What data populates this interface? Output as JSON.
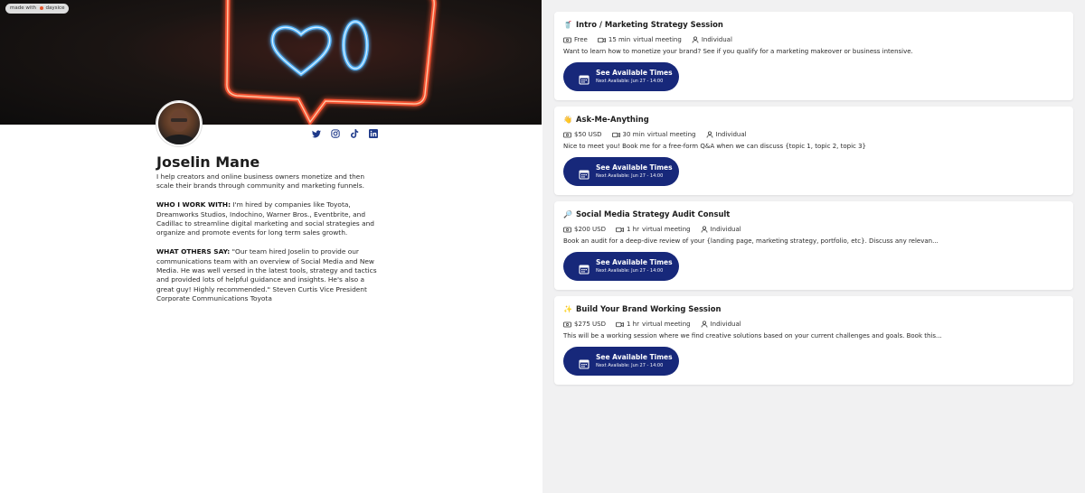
{
  "badge": {
    "made_with": "made with",
    "brand": "daysice"
  },
  "profile": {
    "name": "Joselin Mane",
    "intro": "I help creators and online business owners monetize and then scale their brands through community and marketing funnels.",
    "who_label": "WHO I WORK WITH:",
    "who_text": " I'm hired by companies like Toyota, Dreamworks Studios, Indochino, Warner Bros., Eventbrite, and Cadillac to streamline digital marketing and social strategies and organize and promote events for long term sales growth.",
    "others_label": "WHAT OTHERS SAY:",
    "others_text": " \"Our team hired Joselin to provide our communications team with an overview of Social Media and New Media. He was well versed in the latest tools, strategy and tactics and provided lots of helpful guidance and insights. He's also a great guy! Highly recommended.\" Steven Curtis Vice President Corporate Communications Toyota"
  },
  "socials": [
    "twitter-icon",
    "instagram-icon",
    "tiktok-icon",
    "linkedin-icon"
  ],
  "colors": {
    "button": "#17287a",
    "panel": "#f1f1f2"
  },
  "sessions": [
    {
      "emoji": "🥤",
      "title": "Intro / Marketing Strategy Session",
      "price": "Free",
      "duration": "15 min",
      "location": "virtual meeting",
      "type": "Individual",
      "description": "Want to learn how to monetize your brand? See if you qualify for a marketing makeover or business intensive.",
      "button": "See Available Times",
      "next": "Next Available: Jun 27 - 14:00"
    },
    {
      "emoji": "👋",
      "title": "Ask-Me-Anything",
      "price": "$50 USD",
      "duration": "30 min",
      "location": "virtual meeting",
      "type": "Individual",
      "description": "Nice to meet you! Book me for a free-form Q&A when we can discuss {topic 1, topic 2, topic 3}",
      "button": "See Available Times",
      "next": "Next Available: Jun 27 - 14:00"
    },
    {
      "emoji": "🔎",
      "title": "Social Media Strategy Audit Consult",
      "price": "$200 USD",
      "duration": "1 hr",
      "location": "virtual meeting",
      "type": "Individual",
      "description": "Book an audit for a deep-dive review of your {landing page, marketing strategy, portfolio, etc}. Discuss any relevan...",
      "button": "See Available Times",
      "next": "Next Available: Jun 27 - 14:00"
    },
    {
      "emoji": "✨",
      "title": "Build Your Brand Working Session",
      "price": "$275 USD",
      "duration": "1 hr",
      "location": "virtual meeting",
      "type": "Individual",
      "description": "This will be a working session where we find creative solutions based on your current challenges and goals. Book this...",
      "button": "See Available Times",
      "next": "Next Available: Jun 27 - 14:00"
    }
  ]
}
